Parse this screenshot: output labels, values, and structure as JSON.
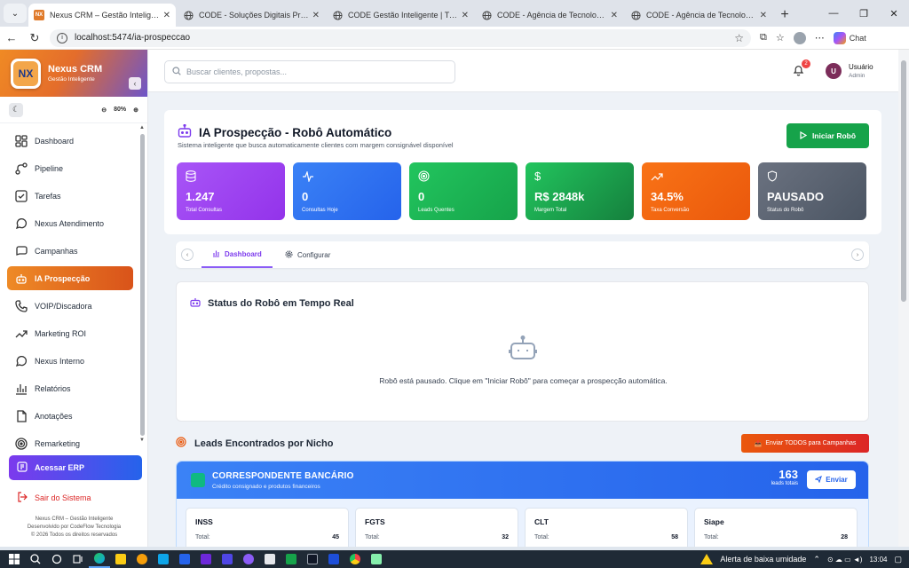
{
  "browser": {
    "tabs": [
      {
        "title": "Nexus CRM – Gestão Inteligente",
        "active": true
      },
      {
        "title": "CODE - Soluções Digitais Profissio",
        "active": false
      },
      {
        "title": "CODE Gestão Inteligente | Transfo",
        "active": false
      },
      {
        "title": "CODE - Agência de Tecnologia Em",
        "active": false
      },
      {
        "title": "CODE - Agência de Tecnologia Em",
        "active": false
      }
    ],
    "url": "localhost:5474/ia-prospeccao",
    "chat_label": "Chat"
  },
  "sidebar": {
    "brand": {
      "logo": "NX",
      "name": "Nexus CRM",
      "subtitle": "Gestão Inteligente"
    },
    "zoom": "80%",
    "items": [
      {
        "label": "Dashboard",
        "icon": "dashboard-icon",
        "active": false
      },
      {
        "label": "Pipeline",
        "icon": "pipeline-icon",
        "active": false
      },
      {
        "label": "Tarefas",
        "icon": "tasks-icon",
        "active": false
      },
      {
        "label": "Nexus Atendimento",
        "icon": "chat-icon",
        "active": false
      },
      {
        "label": "Campanhas",
        "icon": "campaign-icon",
        "active": false
      },
      {
        "label": "IA Prospecção",
        "icon": "robot-icon",
        "active": true
      },
      {
        "label": "VOIP/Discadora",
        "icon": "phone-icon",
        "active": false
      },
      {
        "label": "Marketing ROI",
        "icon": "trend-icon",
        "active": false
      },
      {
        "label": "Nexus Interno",
        "icon": "message-icon",
        "active": false
      },
      {
        "label": "Relatórios",
        "icon": "report-icon",
        "active": false
      },
      {
        "label": "Anotações",
        "icon": "notes-icon",
        "active": false
      },
      {
        "label": "Remarketing",
        "icon": "target-icon",
        "active": false
      }
    ],
    "erp_label": "Acessar ERP",
    "logout_label": "Sair do Sistema",
    "footer": [
      "Nexus CRM – Gestão Inteligente",
      "Desenvolvido por CodeFlow Tecnologia",
      "© 2026 Todos os direitos reservados"
    ]
  },
  "topbar": {
    "search_placeholder": "Buscar clientes, propostas...",
    "notifications": "2",
    "user_initial": "U",
    "user_name": "Usuário",
    "user_role": "Admin"
  },
  "hero": {
    "title": "IA Prospecção - Robô Automático",
    "subtitle": "Sistema inteligente que busca automaticamente clientes com margem consignável disponível",
    "start_label": "Iniciar Robô",
    "stats": [
      {
        "value": "1.247",
        "label": "Total Consultas",
        "icon": "database-icon",
        "color": "#9b3df0"
      },
      {
        "value": "0",
        "label": "Consultas Hoje",
        "icon": "activity-icon",
        "color": "#2f6df0"
      },
      {
        "value": "0",
        "label": "Leads Quentes",
        "icon": "target-icon",
        "color": "#1fae52"
      },
      {
        "value": "R$ 2848k",
        "label": "Margem Total",
        "icon": "dollar-icon",
        "color": "#15a34a"
      },
      {
        "value": "34.5%",
        "label": "Taxa Conversão",
        "icon": "trend-icon",
        "color": "#f2620e"
      },
      {
        "value": "PAUSADO",
        "label": "Status do Robô",
        "icon": "shield-icon",
        "color": "#4b5563"
      }
    ]
  },
  "tabs": {
    "dashboard": "Dashboard",
    "config": "Configurar"
  },
  "status": {
    "title": "Status do Robô em Tempo Real",
    "message": "Robô está pausado. Clique em \"Iniciar Robô\" para começar a prospecção automática."
  },
  "leads": {
    "title": "Leads Encontrados por Nicho",
    "send_all_label": "Enviar TODOS para Campanhas",
    "niche": {
      "title": "CORRESPONDENTE BANCÁRIO",
      "description": "Crédito consignado e produtos financeiros",
      "count": "163",
      "count_label": "leads totais",
      "send_label": "Enviar",
      "cards": [
        {
          "title": "INSS",
          "total_label": "Total:",
          "total": "45"
        },
        {
          "title": "FGTS",
          "total_label": "Total:",
          "total": "32"
        },
        {
          "title": "CLT",
          "total_label": "Total:",
          "total": "58"
        },
        {
          "title": "Siape",
          "total_label": "Total:",
          "total": "28"
        }
      ]
    }
  },
  "taskbar": {
    "alert": "Alerta de baixa umidade",
    "time": "13:04"
  }
}
